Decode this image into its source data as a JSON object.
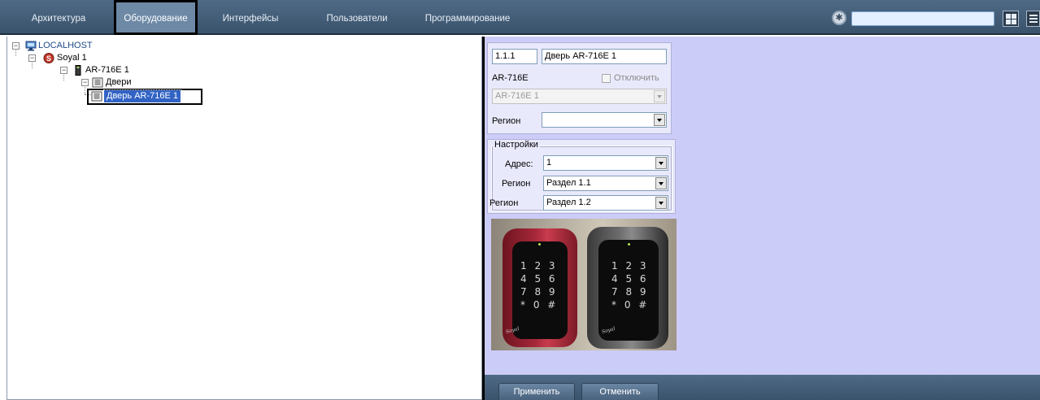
{
  "top_tabs": [
    {
      "label": "Архитектура",
      "active": false
    },
    {
      "label": "Оборудование",
      "active": true
    },
    {
      "label": "Интерфейсы",
      "active": false
    },
    {
      "label": "Пользователи",
      "active": false
    },
    {
      "label": "Программирование",
      "active": false
    }
  ],
  "toolbar": {
    "search_value": "",
    "icons": [
      "gear-icon",
      "grid-view-icon",
      "menu-icon"
    ]
  },
  "tree": {
    "nodes": [
      {
        "label": "LOCALHOST",
        "icon": "computer-icon",
        "expander": "-"
      },
      {
        "label": "Soyal 1",
        "icon": "soyal-controller-icon",
        "expander": "-"
      },
      {
        "label": "AR-716E 1",
        "icon": "controller-device-icon",
        "expander": "-"
      },
      {
        "label": "Двери",
        "icon": "doors-group-icon",
        "expander": "-"
      },
      {
        "label": "Дверь AR-716E  1",
        "icon": "door-icon",
        "selected": true
      }
    ]
  },
  "settings": {
    "object_id": "1.1.1",
    "object_name": "Дверь AR-716E  1",
    "device_type_label": "AR-716E",
    "disable_label": "Отключить",
    "disable_checked": false,
    "device_select": "AR-716E 1",
    "region_label": "Регион",
    "region_value": "",
    "group_title": "Настройки",
    "address_label": "Адрес:",
    "address_value": "1",
    "region1_label": "Регион",
    "region1_value": "Раздел 1.1",
    "region2_label": "Регион",
    "region2_value": "Раздел 1.2"
  },
  "readers": [
    {
      "keys": [
        "1 2 3",
        "4 5 6",
        "7 8 9",
        "* 0 #"
      ],
      "brand": "Soyal",
      "color": "#9b2231"
    },
    {
      "keys": [
        "1 2 3",
        "4 5 6",
        "7 8 9",
        "* 0 #"
      ],
      "brand": "Soyal",
      "color": "#1d1d1d"
    }
  ],
  "buttons": {
    "apply": "Применить",
    "cancel": "Отменить"
  },
  "colors": {
    "topbar": "#3f5873",
    "right_panel": "#ccccf8",
    "selection": "#3163c5"
  }
}
